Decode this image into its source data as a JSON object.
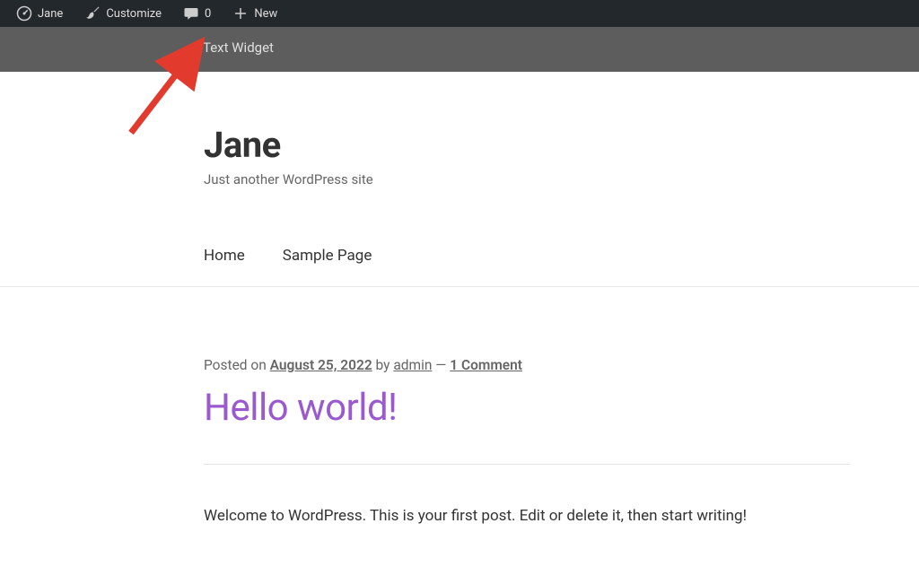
{
  "adminBar": {
    "siteName": "Jane",
    "customize": "Customize",
    "commentsCount": "0",
    "new": "New"
  },
  "widgetBand": {
    "title": "Text Widget"
  },
  "site": {
    "title": "Jane",
    "tagline": "Just another WordPress site"
  },
  "nav": {
    "home": "Home",
    "sample": "Sample Page"
  },
  "post": {
    "postedOn": "Posted on ",
    "date": "August 25, 2022",
    "by": " by ",
    "author": "admin",
    "sep": " — ",
    "comments": "1 Comment",
    "title": "Hello world!",
    "body": "Welcome to WordPress. This is your first post. Edit or delete it, then start writing!"
  }
}
